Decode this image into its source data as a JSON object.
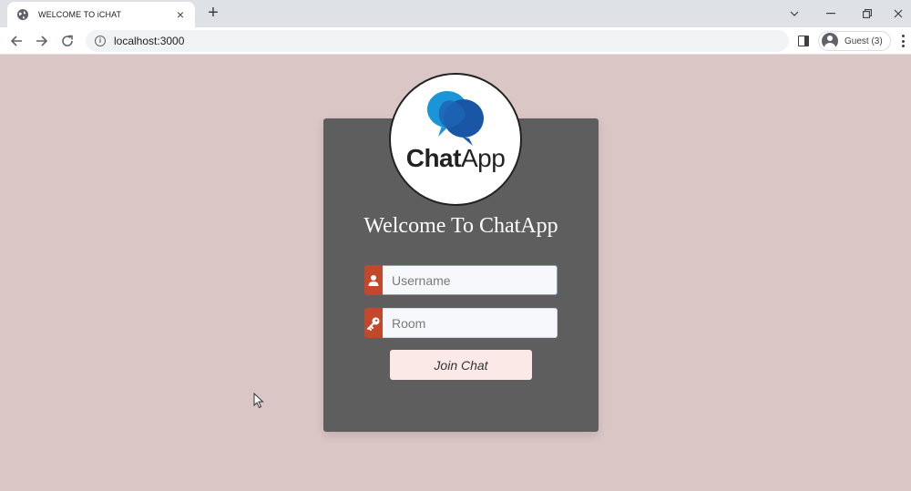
{
  "browser": {
    "tab_title": "WELCOME TO iCHAT",
    "tab_close": "×",
    "new_tab": "+",
    "url": "localhost:3000",
    "profile_label": "Guest (3)",
    "icons": {
      "favicon": "globe-icon",
      "back": "arrow-left-icon",
      "forward": "arrow-right-icon",
      "reload": "reload-icon",
      "site_info": "info-icon",
      "side_panel": "side-panel-icon",
      "menu": "kebab-menu-icon"
    }
  },
  "page": {
    "logo_text_bold": "Chat",
    "logo_text_regular": "App",
    "heading": "Welcome To ChatApp",
    "username": {
      "value": "",
      "placeholder": "Username",
      "icon": "user-icon"
    },
    "room": {
      "value": "",
      "placeholder": "Room",
      "icon": "key-icon"
    },
    "join_label": "Join Chat",
    "colors": {
      "background": "#dbc6c6",
      "card": "#5e5e5e",
      "accent": "#c3472b",
      "button": "#fbe9e8",
      "logo_blue_light": "#1a96d8",
      "logo_blue_dark": "#1957a6"
    }
  }
}
